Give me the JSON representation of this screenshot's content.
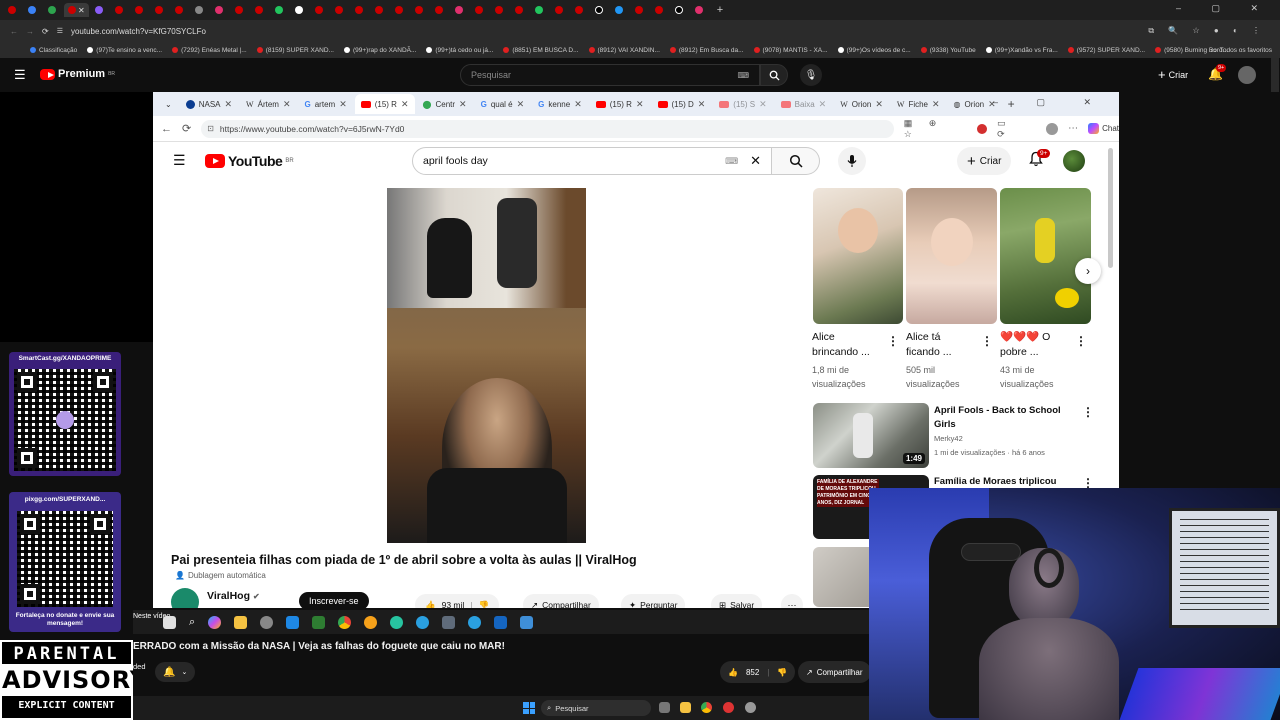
{
  "outer_browser": {
    "url": "youtube.com/watch?v=KfG70SYCLFo",
    "bookmarks": [
      "Classificação",
      "(97)Te ensino a venc...",
      "(7292) Enéas Metal |...",
      "(8159) SUPER XAND...",
      "(99+)rap do XANDÃ...",
      "(99+)tá cedo ou já...",
      "(8851) EM BUSCA D...",
      "(8912) VAI XANDIN...",
      "(8912) Em Busca da...",
      "(9078) MANTIS - XA...",
      "(99+)Os vídeos de c...",
      "(9338) YouTube",
      "(99+)Xandão vs Fra...",
      "(9572) SUPER XAND...",
      "(9580) Burning Bord..."
    ],
    "all_favorites": "Todos os favoritos",
    "youtube_bar": {
      "brand": "Premium",
      "region": "BR",
      "search_placeholder": "Pesquisar",
      "create_label": "Criar",
      "notif_badge": "9+"
    }
  },
  "inner_browser": {
    "tabs": [
      {
        "label": "",
        "icon": "chevron-down"
      },
      {
        "label": "NASA",
        "icon": "nasa"
      },
      {
        "label": "Ártem",
        "icon": "wikipedia"
      },
      {
        "label": "artem",
        "icon": "google"
      },
      {
        "label": "(15) R",
        "icon": "youtube",
        "active": true
      },
      {
        "label": "Centr",
        "icon": "maps"
      },
      {
        "label": "qual é",
        "icon": "google"
      },
      {
        "label": "kenne",
        "icon": "google"
      },
      {
        "label": "(15) R",
        "icon": "youtube"
      },
      {
        "label": "(15) D",
        "icon": "youtube"
      },
      {
        "label": "(15) S",
        "icon": "youtube"
      },
      {
        "label": "Baixa",
        "icon": "youtube"
      },
      {
        "label": "Orion",
        "icon": "wikipedia"
      },
      {
        "label": "Fiche",
        "icon": "wikipedia"
      },
      {
        "label": "Orion",
        "icon": "globe"
      }
    ],
    "url": "https://www.youtube.com/watch?v=6J5rwN-7Yd0",
    "chat_label": "Chat"
  },
  "youtube": {
    "logo_text": "YouTube",
    "region": "BR",
    "search_query": "april fools day",
    "create_label": "Criar",
    "notif_badge": "9+",
    "video": {
      "title": "Pai presenteia filhas com piada de 1º de abril sobre a volta às aulas || ViralHog",
      "dub_label": "Dublagem automática",
      "channel": "ViralHog",
      "subscribe_label": "Inscrever-se",
      "likes": "93 mil",
      "share_label": "Compartilhar",
      "ask_label": "Perguntar",
      "save_label": "Salvar"
    },
    "shorts": [
      {
        "title_lines": [
          "Alice",
          "brincando ..."
        ],
        "views_lines": [
          "1,8 mi de",
          "visualizações"
        ]
      },
      {
        "title_lines": [
          "Alice tá",
          "ficando ..."
        ],
        "views_lines": [
          "505 mil",
          "visualizações"
        ]
      },
      {
        "title_lines": [
          "❤️❤️❤️ O",
          "pobre ..."
        ],
        "views_lines": [
          "43 mi de",
          "visualizações"
        ]
      }
    ],
    "related": [
      {
        "title_lines": [
          "April Fools - Back to School",
          "Girls"
        ],
        "channel": "Merky42",
        "meta": "1 mi de visualizações · há 6 anos",
        "duration": "1:49"
      },
      {
        "title_lines": [
          "Família de Moraes triplicou"
        ],
        "thumb_text": "FAMÍLIA DE ALEXANDRE DE MORAES TRIPLICOU PATRIMÔNIO EM CINCO ANOS, DIZ JORNAL"
      }
    ]
  },
  "overlays": {
    "qr1_label": "SmartCast.gg/XANDAOPRIME",
    "qr2_label": "pixgg.com/SUPERXAND...",
    "qr2_caption": "Fortaleça no donate e envie sua mensagem!",
    "advisory": {
      "line1": "PARENTAL",
      "line2": "ADVISORY",
      "line3": "EXPLICIT CONTENT"
    },
    "neste_video": "Neste vídeo",
    "bottom_video_title": "ERRADO com a Missão da NASA | Veja as falhas do foguete que caiu no MAR!",
    "bottom_ded": "ded",
    "bottom_likes": "852",
    "bottom_share": "Compartilhar",
    "taskbar_search": "Pesquisar"
  }
}
